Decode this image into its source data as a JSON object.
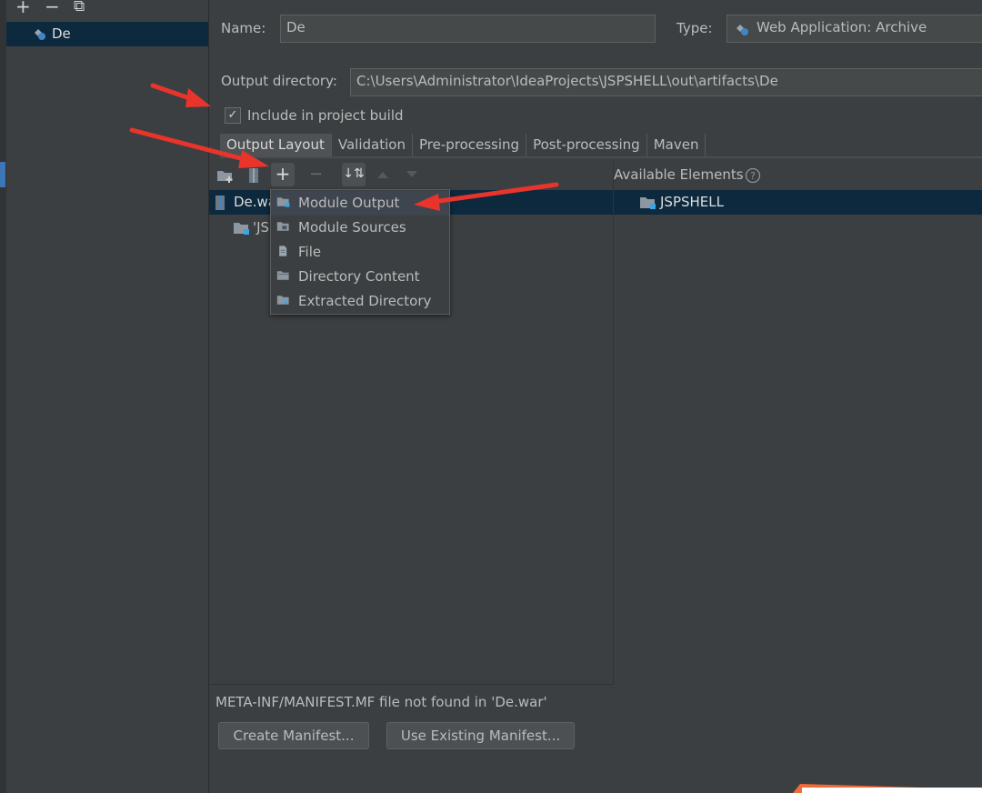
{
  "left_panel": {
    "toolbar": {
      "add": "+",
      "remove": "−",
      "copy": "⧉"
    },
    "artifacts": [
      {
        "label": "De"
      }
    ]
  },
  "form": {
    "name_label": "Name:",
    "name_value": "De",
    "type_label": "Type:",
    "type_value": "Web Application: Archive",
    "output_dir_label": "Output directory:",
    "output_dir_value": "C:\\Users\\Administrator\\IdeaProjects\\JSPSHELL\\out\\artifacts\\De",
    "include_in_build_label": "Include in project build",
    "include_in_build_checked": true
  },
  "tabs": [
    "Output Layout",
    "Validation",
    "Pre-processing",
    "Post-processing",
    "Maven"
  ],
  "active_tab": "Output Layout",
  "layout_tree": {
    "root_label": "De.wa",
    "child_label": "'JS"
  },
  "available_elements": {
    "header": "Available Elements",
    "items": [
      "JSPSHELL"
    ]
  },
  "add_menu": {
    "items": [
      "Module Output",
      "Module Sources",
      "File",
      "Directory Content",
      "Extracted Directory"
    ]
  },
  "manifest": {
    "message": "META-INF/MANIFEST.MF file not found in 'De.war'",
    "create_button": "Create Manifest...",
    "use_existing_button": "Use Existing Manifest..."
  },
  "colors": {
    "background": "#3c3f41",
    "selection": "#0d293e",
    "annotation_arrow": "#e8342a"
  }
}
